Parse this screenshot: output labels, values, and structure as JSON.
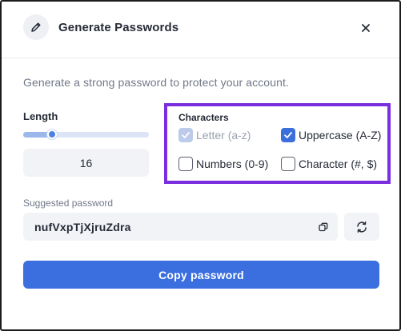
{
  "dialog": {
    "title": "Generate Passwords",
    "description": "Generate a strong password to protect your account."
  },
  "length": {
    "label": "Length",
    "value": "16",
    "slider_fraction": 0.23
  },
  "characters": {
    "label": "Characters",
    "options": [
      {
        "label": "Letter (a-z)",
        "checked": true,
        "disabled": true
      },
      {
        "label": "Uppercase (A-Z)",
        "checked": true,
        "disabled": false
      },
      {
        "label": "Numbers (0-9)",
        "checked": false,
        "disabled": false
      },
      {
        "label": "Character (#, $)",
        "checked": false,
        "disabled": false
      }
    ]
  },
  "suggested": {
    "label": "Suggested password",
    "value": "nufVxpTjXjruZdra"
  },
  "actions": {
    "copy_label": "Copy password"
  },
  "colors": {
    "accent": "#3b6fdf",
    "highlight_border": "#7a2ee0"
  },
  "icons": {
    "header": "pencil-icon",
    "close": "close-icon",
    "copy": "copy-icon",
    "refresh": "refresh-icon"
  }
}
